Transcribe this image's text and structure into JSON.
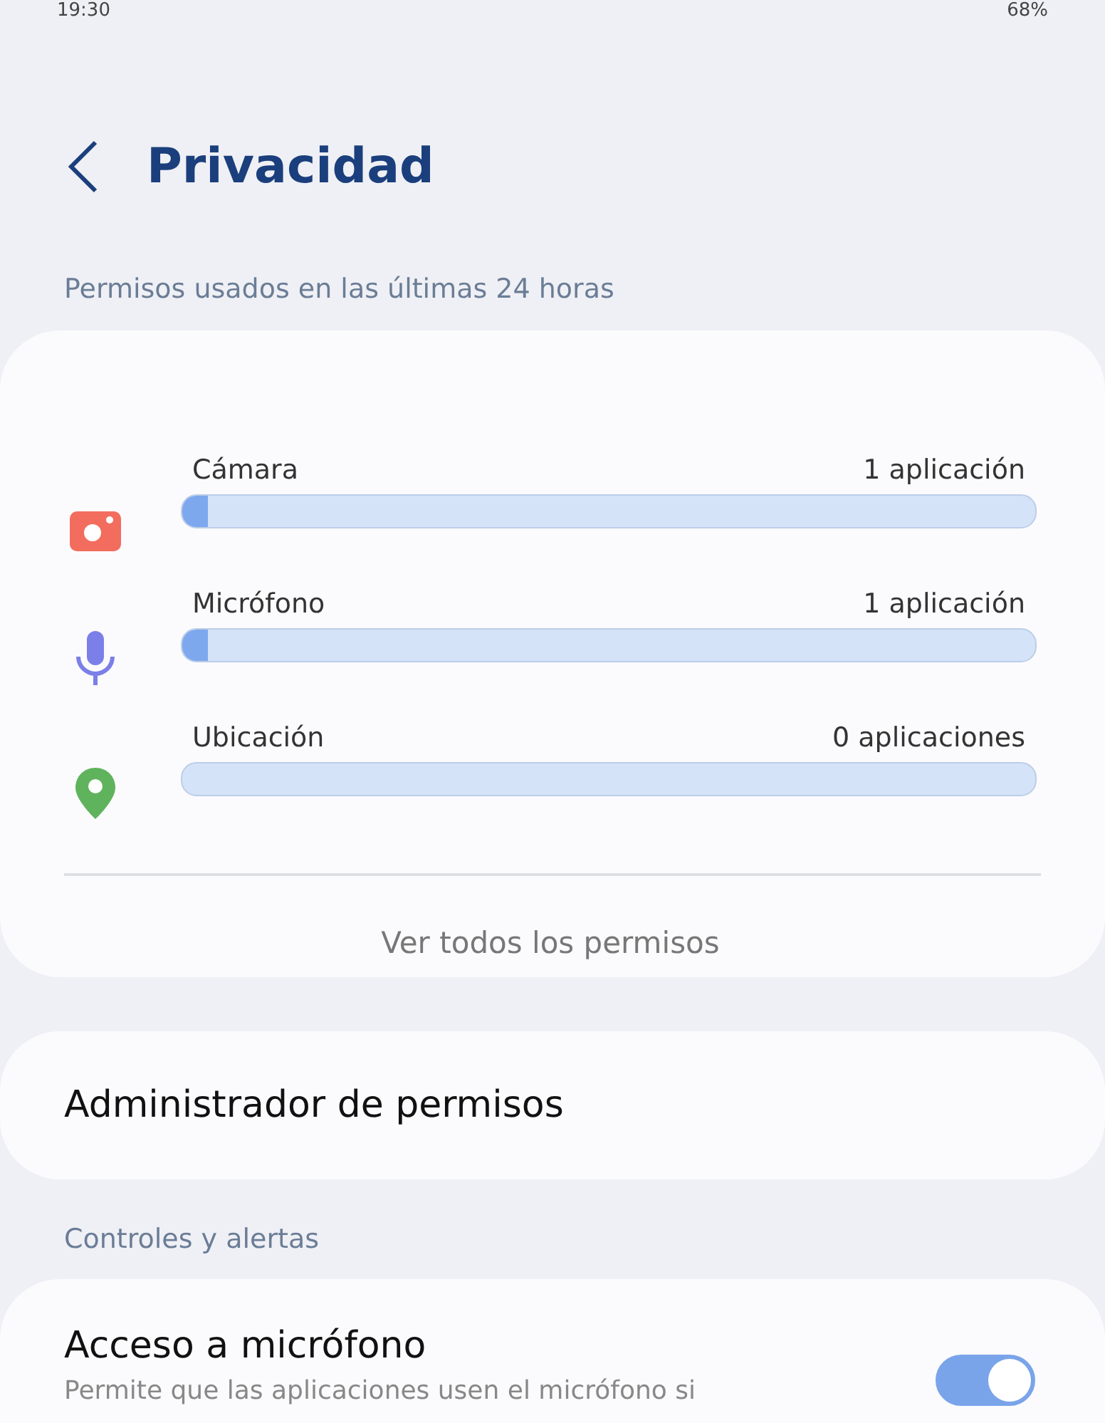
{
  "status_bar": {
    "time": "19:30",
    "battery": "68%"
  },
  "header": {
    "title": "Privacidad"
  },
  "usage_section": {
    "label": "Permisos usados en las últimas 24 horas",
    "items": [
      {
        "kind": "camera",
        "name": "Cámara",
        "count": "1 aplicación",
        "level": 0.03
      },
      {
        "kind": "microphone",
        "name": "Micrófono",
        "count": "1 aplicación",
        "level": 0.03
      },
      {
        "kind": "location",
        "name": "Ubicación",
        "count": "0 aplicaciones"
      }
    ],
    "link": "Ver todos los permisos"
  },
  "manager": {
    "label": "Administrador de permisos"
  },
  "controls_section": {
    "label": "Controles y alertas",
    "items": [
      {
        "title": "Acceso a micrófono",
        "description": "Permite que las aplicaciones usen el micrófono si",
        "on": true
      }
    ]
  }
}
